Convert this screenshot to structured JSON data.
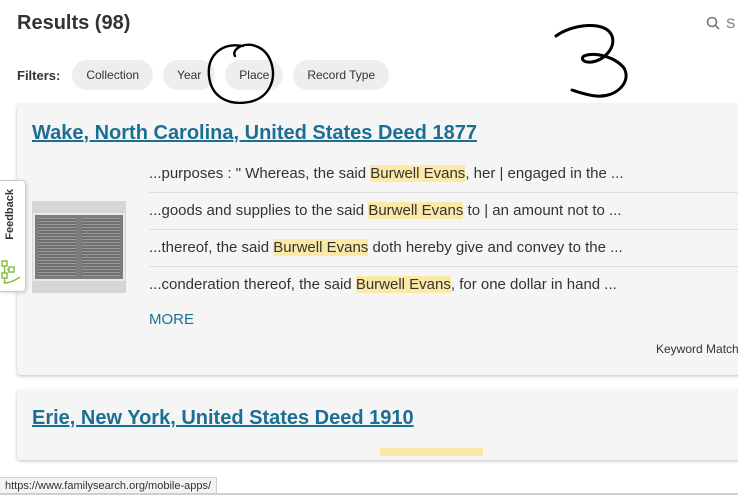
{
  "header": {
    "results_title": "Results (98)",
    "search_partial": "S"
  },
  "filters": {
    "label": "Filters:",
    "chips": [
      "Collection",
      "Year",
      "Place",
      "Record Type"
    ]
  },
  "annotations": {
    "drawn_number": "3"
  },
  "results": [
    {
      "title": "Wake, North Carolina, United States Deed 1877",
      "snippets": [
        {
          "before": "...purposes : \" Whereas, the said ",
          "match": "Burwell Evans",
          "after": ", her | engaged in the ..."
        },
        {
          "before": "...goods and supplies to the said ",
          "match": "Burwell Evans",
          "after": " to | an amount not to ..."
        },
        {
          "before": "...thereof, the said ",
          "match": "Burwell Evans",
          "after": " doth hereby give and convey to the ..."
        },
        {
          "before": "...conderation thereof, the said ",
          "match": "Burwell Evans",
          "after": ", for one dollar in hand ..."
        }
      ],
      "more_label": "MORE",
      "keyword_label": "Keyword Match"
    },
    {
      "title": "Erie, New York, United States Deed 1910"
    }
  ],
  "feedback": {
    "label": "Feedback"
  },
  "status_bar": {
    "url": "https://www.familysearch.org/mobile-apps/"
  },
  "colors": {
    "link": "#1b6f93",
    "highlight": "#fbe9a8",
    "chip_bg": "#eeeeee",
    "card_bg": "#f5f5f5"
  }
}
